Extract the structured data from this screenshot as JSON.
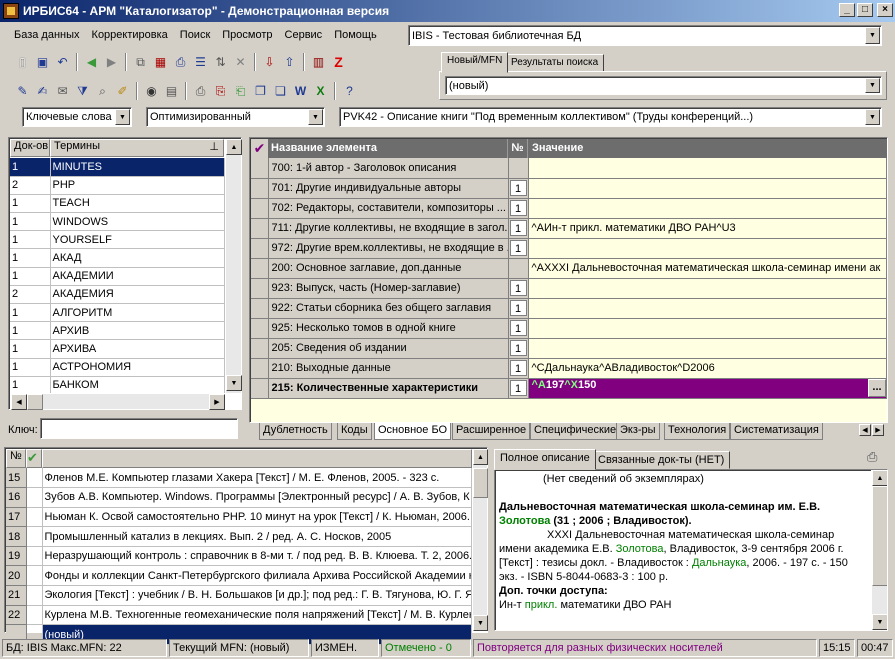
{
  "window": {
    "title": "ИРБИС64 - АРМ \"Каталогизатор\" - Демонстрационная версия",
    "buttons": [
      "_",
      "□",
      "×"
    ]
  },
  "menu": [
    "База данных",
    "Корректировка",
    "Поиск",
    "Просмотр",
    "Сервис",
    "Помощь"
  ],
  "database_combo": "IBIS - Тестовая библиотечная БД",
  "right_tabs": [
    "Новый/MFN",
    "Результаты поиска"
  ],
  "new_mfn_combo": "(новый)",
  "dict_combo": "Ключевые слова",
  "worksheet_combo": "Оптимизированный",
  "rvk_combo": "PVK42 - Описание книги \"Под временным коллективом\" (Труды конференций...)",
  "terms": {
    "headers": [
      "Док-ов",
      "Термины"
    ],
    "rows": [
      {
        "count": "1",
        "term": "MINUTES"
      },
      {
        "count": "2",
        "term": "PHP"
      },
      {
        "count": "1",
        "term": "TEACH"
      },
      {
        "count": "1",
        "term": "WINDOWS"
      },
      {
        "count": "1",
        "term": "YOURSELF"
      },
      {
        "count": "1",
        "term": "АКАД"
      },
      {
        "count": "1",
        "term": "АКАДЕМИИ"
      },
      {
        "count": "2",
        "term": "АКАДЕМИЯ"
      },
      {
        "count": "1",
        "term": "АЛГОРИТМ"
      },
      {
        "count": "1",
        "term": "АРХИВ"
      },
      {
        "count": "1",
        "term": "АРХИВА"
      },
      {
        "count": "1",
        "term": "АСТРОНОМИЯ"
      },
      {
        "count": "1",
        "term": "БАНКОМ"
      }
    ],
    "key_label": "Ключ:",
    "key_value": ""
  },
  "fields": {
    "headers": [
      "Название элемента",
      "№",
      "Значение"
    ],
    "rows": [
      {
        "name": "700: 1-й автор - Заголовок описания",
        "num": "",
        "value": ""
      },
      {
        "name": "701: Другие индивидуальные авторы",
        "num": "1",
        "value": ""
      },
      {
        "name": "702: Редакторы, составители, композиторы ...",
        "num": "1",
        "value": ""
      },
      {
        "name": "711: Другие коллективы, не входящие в загол...",
        "num": "1",
        "value": "^AИн-т прикл. математики ДВО РАН^U3"
      },
      {
        "name": "972: Другие врем.коллективы, не входящие в ...",
        "num": "1",
        "value": ""
      },
      {
        "name": "200: Основное заглавие, доп.данные",
        "num": "",
        "value": "^AXXXI Дальневосточная математическая школа-семинар имени ак"
      },
      {
        "name": "923: Выпуск, часть (Номер-заглавие)",
        "num": "1",
        "value": ""
      },
      {
        "name": "922: Статьи сборника без общего заглавия",
        "num": "1",
        "value": ""
      },
      {
        "name": "925: Несколько томов в одной книге",
        "num": "1",
        "value": ""
      },
      {
        "name": "205: Сведения об издании",
        "num": "1",
        "value": ""
      },
      {
        "name": "210: Выходные данные",
        "num": "1",
        "value": "^CДальнаука^AВладивосток^D2006"
      },
      {
        "name": "215: Количественные характеристики",
        "num": "1",
        "value_a_mark": "^A",
        "value_a": "197",
        "value_x_mark": "^X",
        "value_x": "150",
        "value": "",
        "ellipsis": "..."
      }
    ]
  },
  "worksheet_tabs": [
    "Дублетность",
    "Коды",
    "Основное БО",
    "Расширенное",
    "Специфические",
    "Экз-ры",
    "Технология",
    "Систематизация"
  ],
  "records": {
    "header_no": "№",
    "check_mark": "✔",
    "rows": [
      {
        "no": "15",
        "text": "Фленов М.Е. Компьютер глазами Хакера [Текст] / М. Е. Фленов, 2005. - 323 с."
      },
      {
        "no": "16",
        "text": "Зубов А.В. Компьютер. Windows. Программы [Электронный ресурс] / А. В. Зубов, К"
      },
      {
        "no": "17",
        "text": "Ньюман К. Освой самостоятельно PHP. 10 минут на урок [Текст] / К. Ньюман, 2006."
      },
      {
        "no": "18",
        "text": "Промышленный катализ в лекциях. Вып. 2 / ред. А. С. Носков, 2005"
      },
      {
        "no": "19",
        "text": "Неразрушающий контроль : справочник в 8-ми т. / под ред. В. В. Клюева. Т. 2, 2006."
      },
      {
        "no": "20",
        "text": "Фонды и коллекции Санкт-Петербургского филиала Архива Российской Академии н"
      },
      {
        "no": "21",
        "text": "Экология [Текст] : учебник / В. Н. Большаков [и др.]; под ред.: Г. В. Тягунова, Ю. Г. Я"
      },
      {
        "no": "22",
        "text": "Курлена М.В. Техногенные геомеханические поля напряжений [Текст] / М. В. Курлен"
      },
      {
        "no": "",
        "text": "(новый)"
      }
    ]
  },
  "desc_tabs": [
    "Полное описание",
    "Связанные док-ты (НЕТ)"
  ],
  "description": {
    "no_copies": "(Нет сведений об экземплярах)",
    "head1": "Дальневосточная математическая школа-семинар им. Е.В.",
    "head2_link": "Золотова",
    "head2_rest": " (31 ; 2006 ; Владивосток).",
    "body1": "XXXI Дальневосточная математическая школа-семинар",
    "body2a": "имени академика Е.В. ",
    "body2_link": "Золотова",
    "body2b": ", Владивосток, 3-9 сентября 2006 г.",
    "body3a": "[Текст] : тезисы докл. - Владивосток : ",
    "body3_link": "Дальнаука",
    "body3b": ", 2006. - 197 с. - 150",
    "body4": "экз. - ISBN 5-8044-0683-3 : 100 р.",
    "access_title": "Доп. точки доступа:",
    "access_a": "Ин-т ",
    "access_link": "прикл.",
    "access_b": " математики ДВО РАН"
  },
  "statusbar": {
    "db": "БД: IBIS Макс.MFN: 22",
    "mfn": "Текущий MFN: (новый)",
    "changed": "ИЗМЕН.",
    "marked": "Отмечено - 0",
    "repeat": "Повторяется для разных физических носителей",
    "time1": "15:15",
    "time2": "00:47"
  }
}
